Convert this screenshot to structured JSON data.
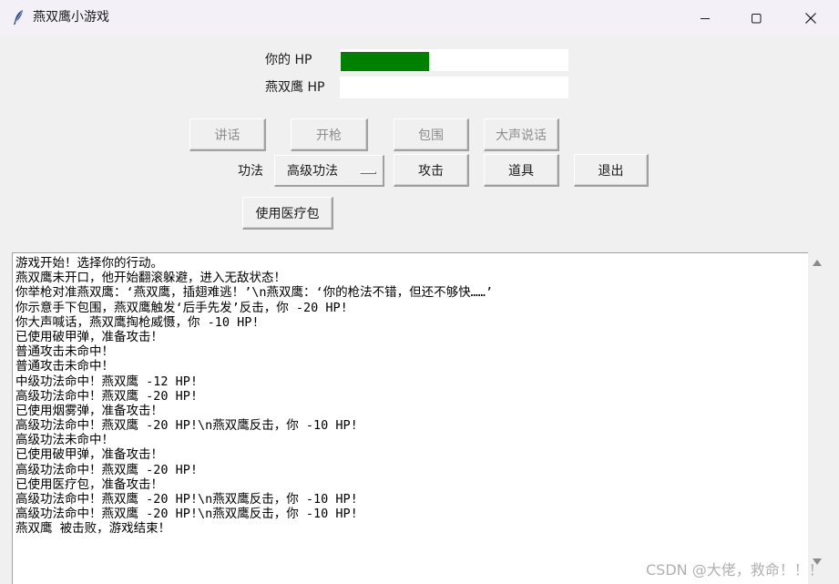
{
  "window": {
    "title": "燕双鹰小游戏",
    "icon": "feather-icon",
    "controls": [
      "minimize-icon",
      "maximize-icon",
      "close-icon"
    ]
  },
  "hp": {
    "player_label": "你的 HP",
    "player_fraction": 0.39,
    "player_color": "#008000",
    "enemy_label": "燕双鹰 HP",
    "enemy_fraction": 0
  },
  "actions": {
    "talk": "讲话",
    "shoot": "开枪",
    "surround": "包围",
    "shout": "大声说话",
    "technique_label": "功法",
    "technique_selected": "高级功法",
    "attack": "攻击",
    "items": "道具",
    "quit": "退出",
    "use_medkit": "使用医疗包"
  },
  "log": {
    "lines": [
      "游戏开始！选择你的行动。",
      "燕双鹰未开口，他开始翻滚躲避，进入无敌状态！",
      "你举枪对准燕双鹰：‘燕双鹰，插翅难逃！’\\n燕双鹰：‘你的枪法不错，但还不够快……’",
      "你示意手下包围，燕双鹰触发‘后手先发’反击，你 -20 HP!",
      "你大声喊话，燕双鹰掏枪威慑，你 -10 HP!",
      "已使用破甲弹，准备攻击！",
      "普通攻击未命中！",
      "普通攻击未命中！",
      "中级功法命中！燕双鹰 -12 HP!",
      "高级功法命中！燕双鹰 -20 HP!",
      "已使用烟雾弹，准备攻击！",
      "高级功法命中！燕双鹰 -20 HP!\\n燕双鹰反击，你 -10 HP!",
      "高级功法未命中！",
      "已使用破甲弹，准备攻击！",
      "高级功法命中！燕双鹰 -20 HP!",
      "已使用医疗包，准备攻击！",
      "高级功法命中！燕双鹰 -20 HP!\\n燕双鹰反击，你 -10 HP!",
      "高级功法命中！燕双鹰 -20 HP!\\n燕双鹰反击，你 -10 HP!",
      "燕双鹰 被击败，游戏结束！"
    ]
  },
  "watermark": "CSDN @大佬，救命！！！"
}
